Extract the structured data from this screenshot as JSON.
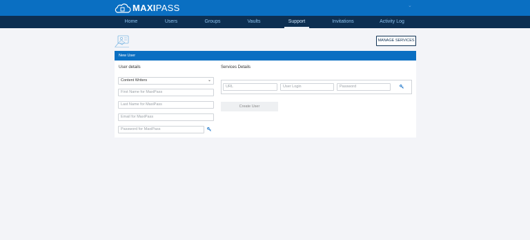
{
  "brand": {
    "name_bold": "MAXI",
    "name_rest": "PASS"
  },
  "user_menu": {
    "chevron": "⌄"
  },
  "nav": {
    "items": [
      {
        "label": "Home"
      },
      {
        "label": "Users"
      },
      {
        "label": "Groups"
      },
      {
        "label": "Vaults"
      },
      {
        "label": "Support",
        "active": true
      },
      {
        "label": "Invitations"
      },
      {
        "label": "Activity Log"
      }
    ]
  },
  "actions": {
    "manage_services": "MANAGE SERVICES"
  },
  "card": {
    "title": "New User",
    "user_details": {
      "title": "User details",
      "group_select": "Content Writers",
      "first_name_placeholder": "First Name for MaxiPass",
      "last_name_placeholder": "Last Name for MaxiPass",
      "email_placeholder": "Email for MaxiPass",
      "password_placeholder": "Password for MaxiPass"
    },
    "services_details": {
      "title": "Services Details",
      "url_placeholder": "URL",
      "login_placeholder": "User Login",
      "password_placeholder": "Password",
      "create_button": "Create User"
    }
  },
  "colors": {
    "brand": "#0a6fc2",
    "nav": "#0d2f52",
    "background": "#f3f4f8"
  },
  "icons": [
    "cloud-logo-icon",
    "users-illustration-icon",
    "key-icon",
    "chevron-down-icon"
  ]
}
